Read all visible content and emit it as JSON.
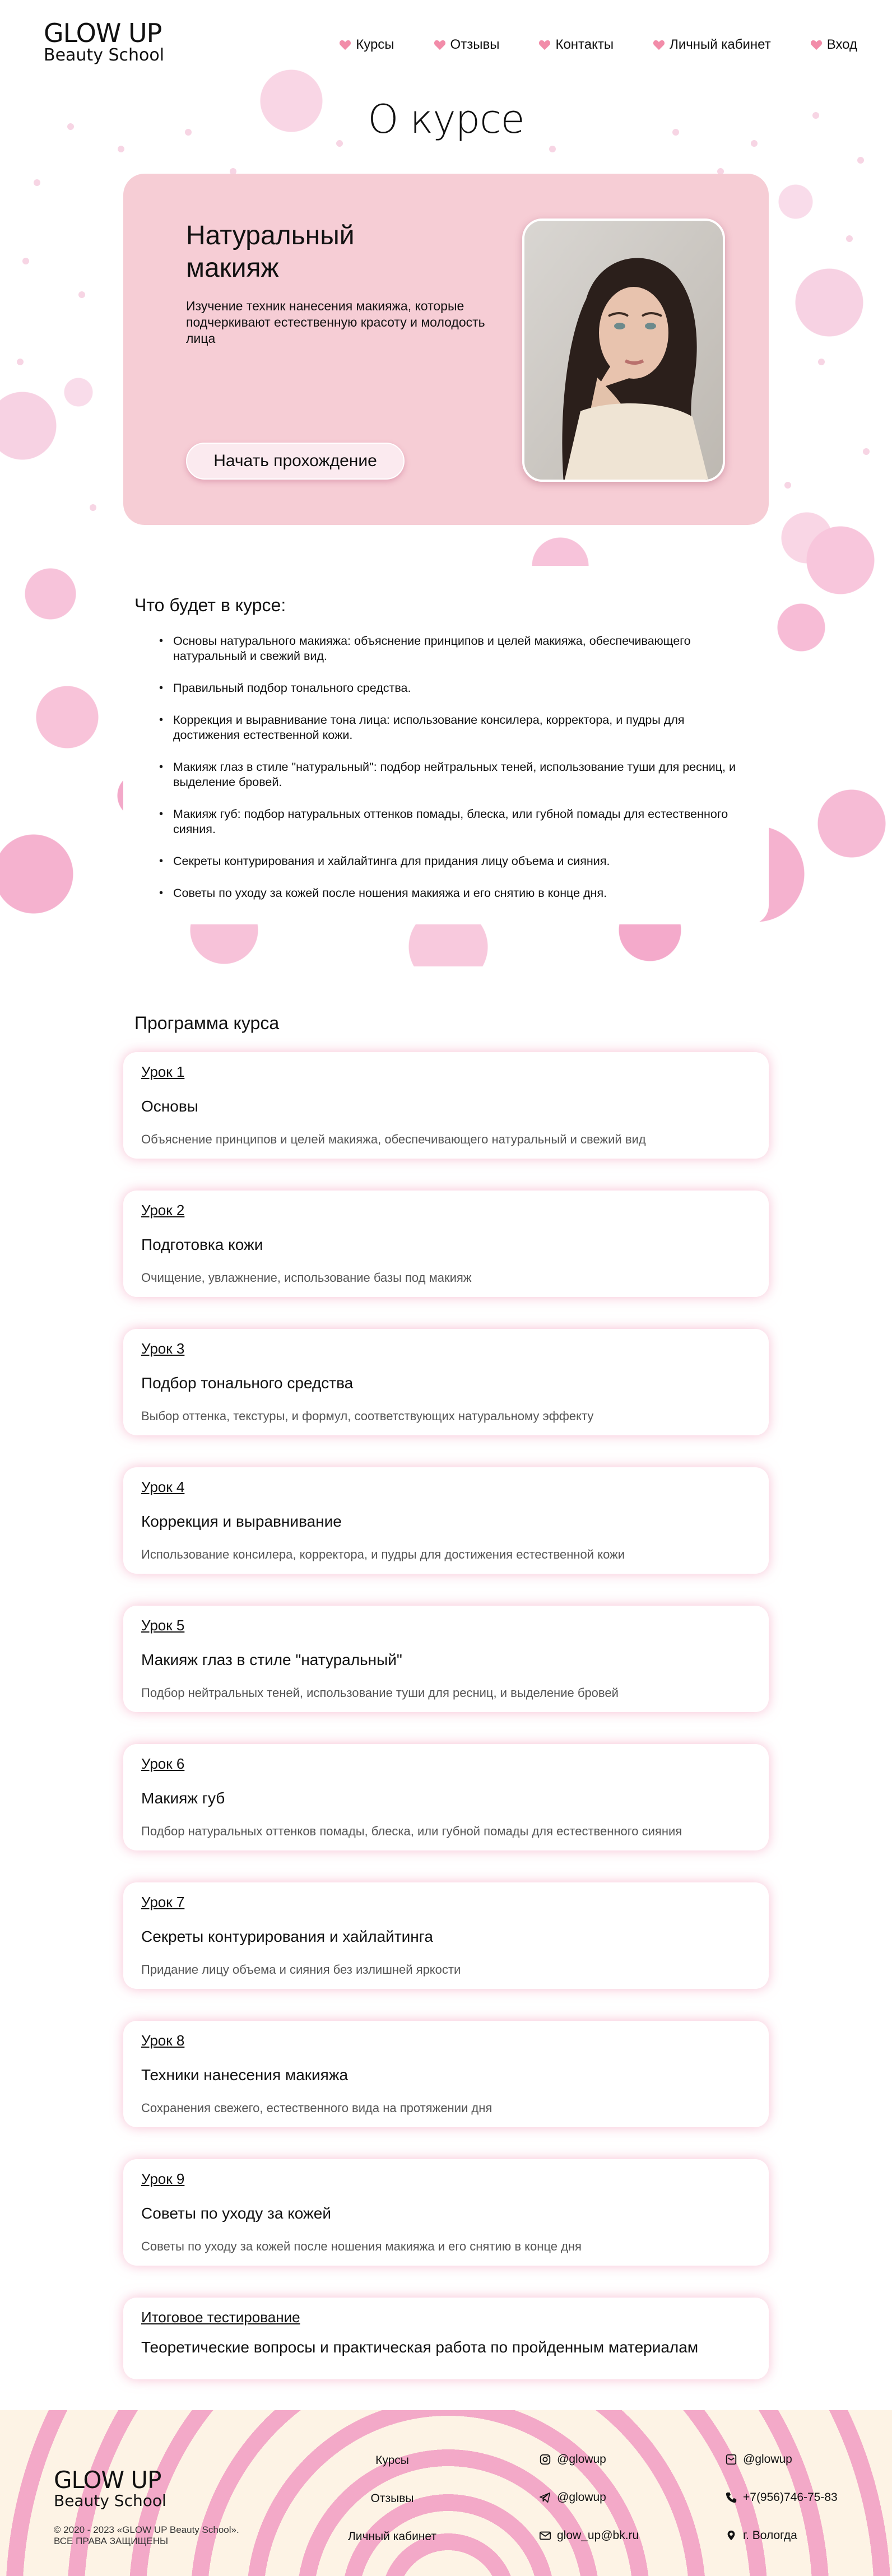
{
  "header": {
    "logo_line1": "GLOW UP",
    "logo_line2": "Beauty School",
    "nav": [
      {
        "label": "Курсы"
      },
      {
        "label": "Отзывы"
      },
      {
        "label": "Контакты"
      },
      {
        "label": "Личный кабинет"
      },
      {
        "label": "Вход"
      }
    ]
  },
  "page_title": "О курсе",
  "course": {
    "title": "Натуральный макияж",
    "description": "Изучение техник нанесения макияжа, которые подчеркивают естественную красоту и молодость лица",
    "start_button": "Начать прохождение"
  },
  "learn": {
    "heading": "Что будет в курсе:",
    "items": [
      "Основы натурального макияжа: объяснение принципов и целей макияжа, обеспечивающего натуральный и свежий вид.",
      "Правильный подбор тонального средства.",
      "Коррекция и выравнивание тона лица: использование консилера, корректора, и пудры для достижения естественной кожи.",
      "Макияж глаз в стиле \"натуральный\": подбор нейтральных теней, использование туши для ресниц, и выделение бровей.",
      "Макияж губ: подбор натуральных оттенков помады, блеска, или губной помады для естественного сияния.",
      "Секреты контурирования и хайлайтинга для придания лицу объема и сияния.",
      "Советы по уходу за кожей после ношения макияжа и его снятию в конце дня."
    ]
  },
  "program": {
    "heading": "Программа курса",
    "lessons": [
      {
        "num": "Урок 1",
        "name": "Основы",
        "text": "Объяснение принципов и целей макияжа, обеспечивающего натуральный и свежий вид"
      },
      {
        "num": "Урок 2",
        "name": "Подготовка кожи",
        "text": "Очищение, увлажнение, использование базы под макияж"
      },
      {
        "num": "Урок 3",
        "name": "Подбор тонального средства",
        "text": "Выбор оттенка, текстуры, и формул, соответствующих натуральному эффекту"
      },
      {
        "num": "Урок 4",
        "name": "Коррекция и выравнивание",
        "text": "Использование консилера, корректора, и пудры для достижения естественной кожи"
      },
      {
        "num": "Урок 5",
        "name": "Макияж глаз в стиле \"натуральный\"",
        "text": "Подбор нейтральных теней, использование туши для ресниц, и выделение бровей"
      },
      {
        "num": "Урок 6",
        "name": "Макияж губ",
        "text": "Подбор натуральных оттенков помады, блеска, или губной помады для естественного сияния"
      },
      {
        "num": "Урок 7",
        "name": "Секреты контурирования и хайлайтинга",
        "text": "Придание лицу объема и сияния без излишней яркости"
      },
      {
        "num": "Урок 8",
        "name": "Техники нанесения макияжа",
        "text": "Сохранения свежего, естественного вида на протяжении дня"
      },
      {
        "num": "Урок 9",
        "name": "Советы по уходу за кожей",
        "text": "Советы по уходу за кожей после ношения макияжа и его снятию в конце дня"
      }
    ],
    "final": {
      "num": "Итоговое тестирование",
      "name": "Теоретические вопросы и практическая работа по пройденным материалам"
    }
  },
  "footer": {
    "logo_line1": "GLOW UP",
    "logo_line2": "Beauty School",
    "copyright": "© 2020 - 2023 «GLOW UP Beauty School». ВСЕ ПРАВА ЗАЩИЩЕНЫ",
    "links": [
      "Курсы",
      "Отзывы",
      "Личный кабинет"
    ],
    "instagram": "@glowup",
    "telegram": "@glowup",
    "email": "glow_up@bk.ru",
    "mail_handle": "@glowup",
    "phone": "+7(956)746-75-83",
    "city": "г. Вологда"
  },
  "colors": {
    "accent_pink": "#f6cdd5",
    "heart": "#f28ca9",
    "text": "#111111"
  }
}
